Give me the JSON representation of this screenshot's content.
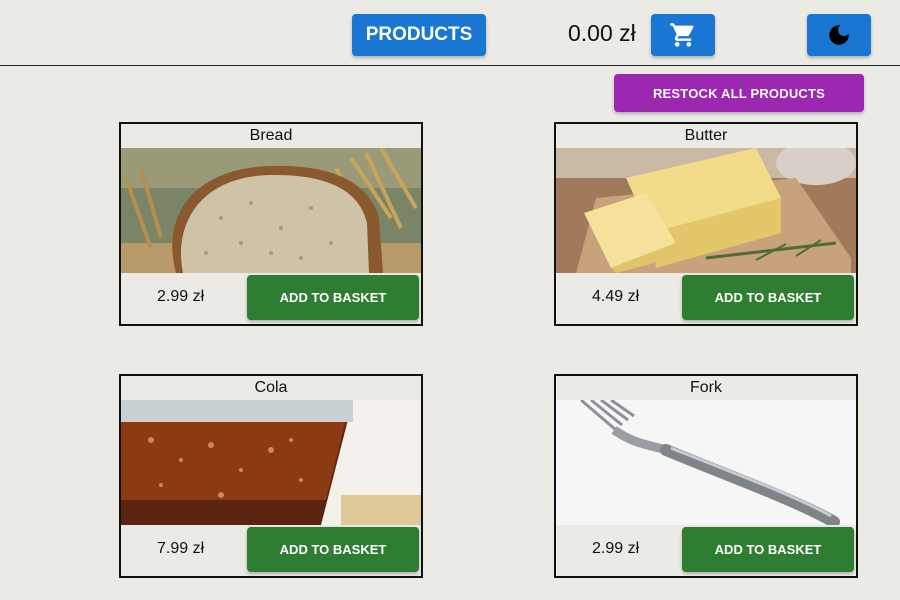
{
  "header": {
    "products_label": "PRODUCTS",
    "total": "0.00 zł",
    "cart_icon": "shopping-cart-icon",
    "theme_icon": "moon-icon"
  },
  "actions": {
    "restock_label": "RESTOCK ALL PRODUCTS"
  },
  "products": [
    {
      "name": "Bread",
      "price": "2.99 zł",
      "button": "ADD TO BASKET",
      "image": "bread-photo"
    },
    {
      "name": "Butter",
      "price": "4.49 zł",
      "button": "ADD TO BASKET",
      "image": "butter-photo"
    },
    {
      "name": "Cola",
      "price": "7.99 zł",
      "button": "ADD TO BASKET",
      "image": "cola-photo"
    },
    {
      "name": "Fork",
      "price": "2.99 zł",
      "button": "ADD TO BASKET",
      "image": "fork-photo"
    }
  ],
  "colors": {
    "primary": "#1976d2",
    "restock": "#9c27b0",
    "add_to_basket": "#2e7d32",
    "background": "#ebeae5"
  }
}
